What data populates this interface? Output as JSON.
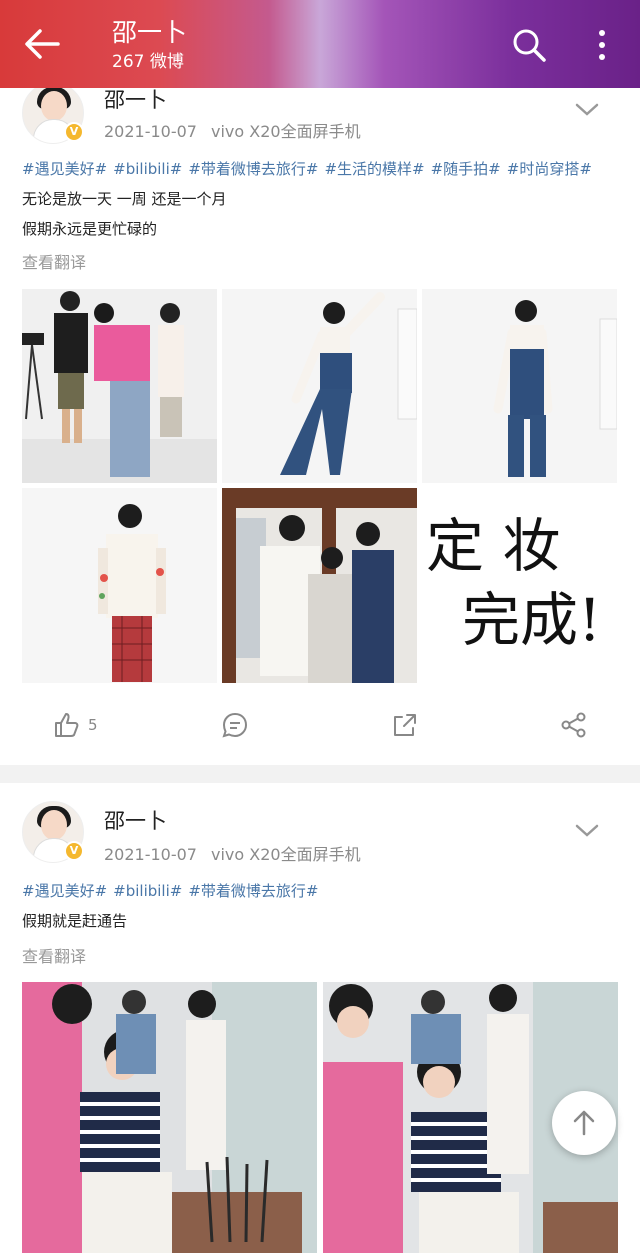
{
  "header": {
    "title": "邵一卜",
    "subtitle": "267 微博",
    "back_icon": "back-arrow-icon",
    "search_icon": "search-icon",
    "more_icon": "more-vertical-icon"
  },
  "posts": [
    {
      "username": "邵一卜",
      "date": "2021-10-07",
      "device": "vivo X20全面屏手机",
      "tags": [
        "#遇见美好#",
        "#bilibili#",
        "#带着微博去旅行#",
        "#生活的模样#",
        "#随手拍#",
        "#时尚穿搭#"
      ],
      "lines": [
        "无论是放一天 一周 还是一个月",
        "假期永远是更忙碌的"
      ],
      "translate_label": "查看翻译",
      "images": [
        {
          "name": "photo-studio-makeup"
        },
        {
          "name": "photo-overalls-pose"
        },
        {
          "name": "photo-overalls-standing"
        },
        {
          "name": "photo-sweater-plaid-pants"
        },
        {
          "name": "photo-group-three"
        },
        {
          "name": "photo-handwriting",
          "caption_line1": "定 妆",
          "caption_line2": "完成!"
        }
      ],
      "like_count": "5"
    },
    {
      "username": "邵一卜",
      "date": "2021-10-07",
      "device": "vivo X20全面屏手机",
      "tags": [
        "#遇见美好#",
        "#bilibili#",
        "#带着微博去旅行#"
      ],
      "lines": [
        "假期就是赶通告"
      ],
      "translate_label": "查看翻译",
      "images": [
        {
          "name": "photo-makeup-chair-1"
        },
        {
          "name": "photo-makeup-chair-2"
        }
      ]
    }
  ],
  "colors": {
    "link": "#4a77a8",
    "verified_badge": "#f5b82e",
    "meta_gray": "#8a8a8a"
  }
}
